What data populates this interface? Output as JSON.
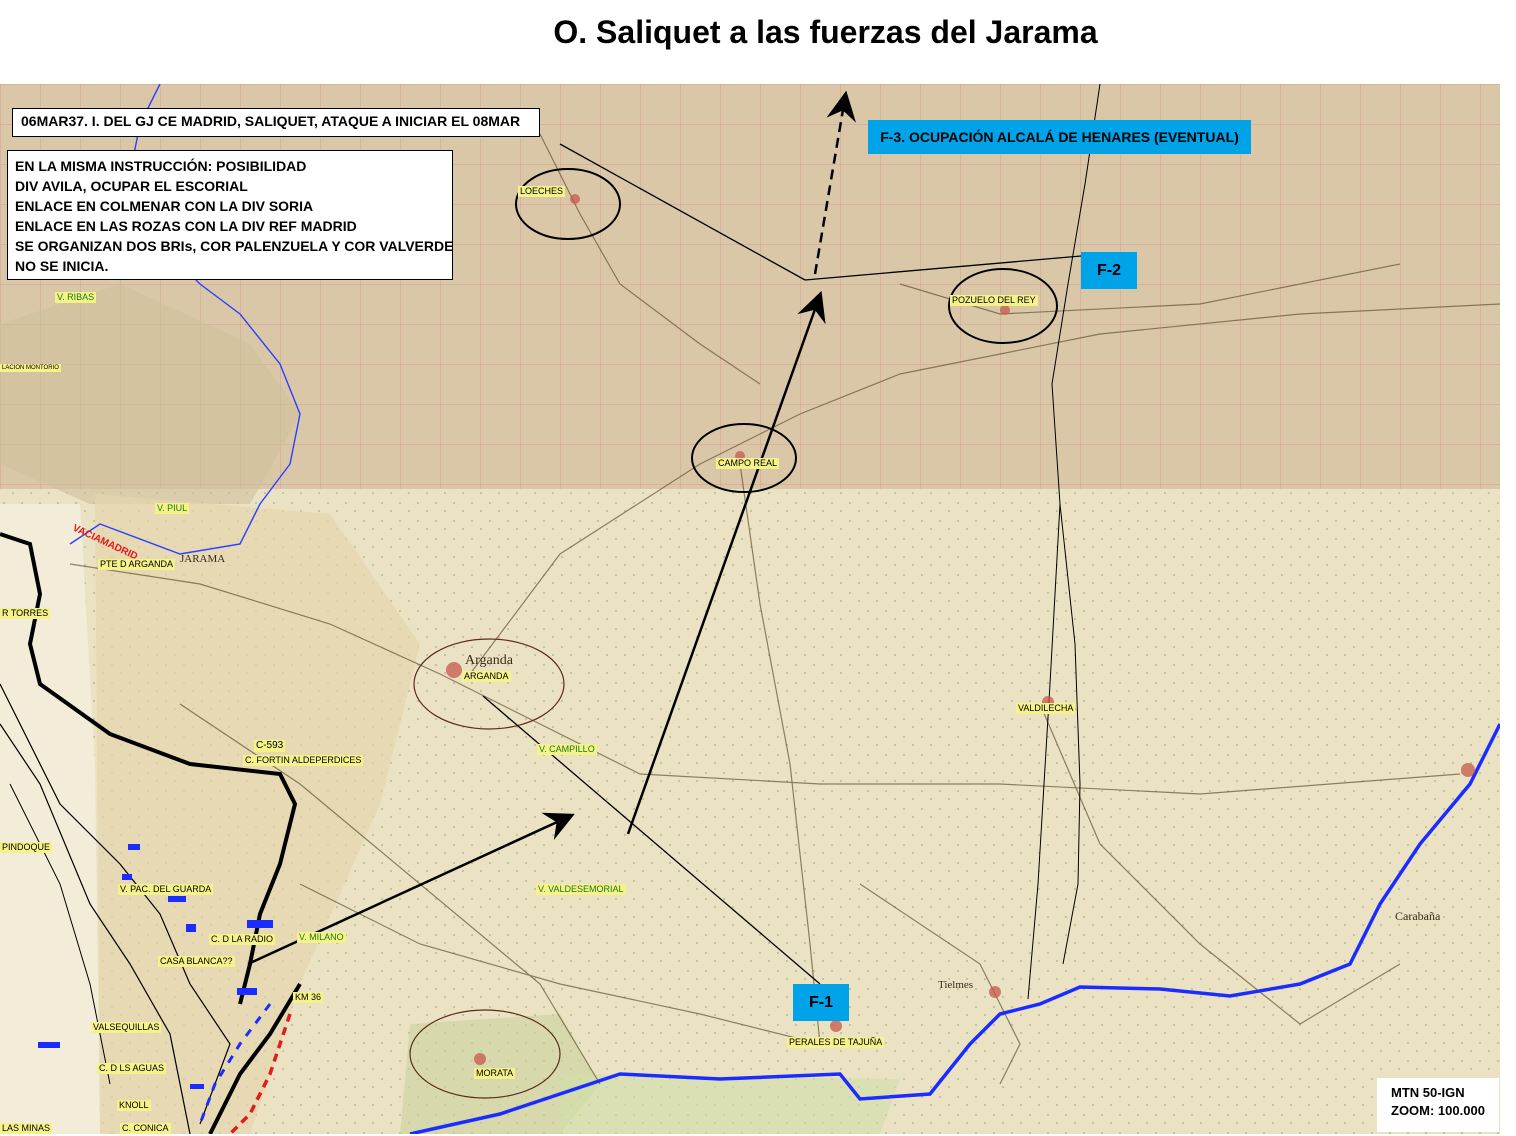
{
  "title": "O. Saliquet a las fuerzas del Jarama",
  "info_box_1": "06MAR37. I. DEL GJ CE MADRID, SALIQUET, ATAQUE A INICIAR EL 08MAR",
  "info_box_2": [
    "EN LA MISMA INSTRUCCIÓN: POSIBILIDAD",
    "DIV AVILA, OCUPAR EL ESCORIAL",
    "ENLACE EN COLMENAR CON LA DIV SORIA",
    "ENLACE EN LAS ROZAS CON LA DIV REF MADRID",
    "SE ORGANIZAN DOS BRIs, COR PALENZUELA Y COR VALVERDE",
    "NO SE INICIA."
  ],
  "labels": {
    "f3": "F-3. OCUPACIÓN ALCALÁ DE HENARES (EVENTUAL)",
    "f2": "F-2",
    "f1": "F-1"
  },
  "scale_box": [
    "MTN 50-IGN",
    "ZOOM: 100.000"
  ],
  "places": {
    "loeches": "LOECHES",
    "pozuelo": "POZUELO DEL REY",
    "campo_real": "CAMPO REAL",
    "arganda": "ARGANDA",
    "valdilecha": "VALDILECHA",
    "perales": "PERALES DE TAJUÑA",
    "morata": "MORATA",
    "v_ribas": "V. RIBAS",
    "v_piul": "V. PIUL",
    "pte_arganda": "PTE D ARGANDA",
    "c593": "C-593",
    "fortin": "C. FORTIN ALDEPERDICES",
    "v_campillo": "V. CAMPILLO",
    "v_valdesemorial": "V. VALDESEMORIAL",
    "pindoque": "PINDOQUE",
    "pac_guarda": "V. PAC. DEL GUARDA",
    "radio": "C. D LA RADIO",
    "v_milano": "V. MILANO",
    "casa_blanca": "CASA BLANCA??",
    "km36": "KM 36",
    "valsequillas": "VALSEQUILLAS",
    "aguas": "C. D LS AGUAS",
    "knoll": "KNOLL",
    "minas": "LAS MINAS",
    "conica": "C. CONICA",
    "torres": "R TORRES",
    "vaciamadrid": "VACIAMADRID",
    "montoreo": "LACION MONTORIO"
  },
  "map_text": {
    "arganda_map": "Arganda",
    "carabana": "Carabaña",
    "tielmes": "Tielmes",
    "jarama": "JARAMA"
  },
  "colors": {
    "river": "#1a2cff",
    "front": "#000000",
    "label_blue": "#00a2e8",
    "label_yellow": "#f6f28a",
    "map_grid": "#d47b7b"
  }
}
